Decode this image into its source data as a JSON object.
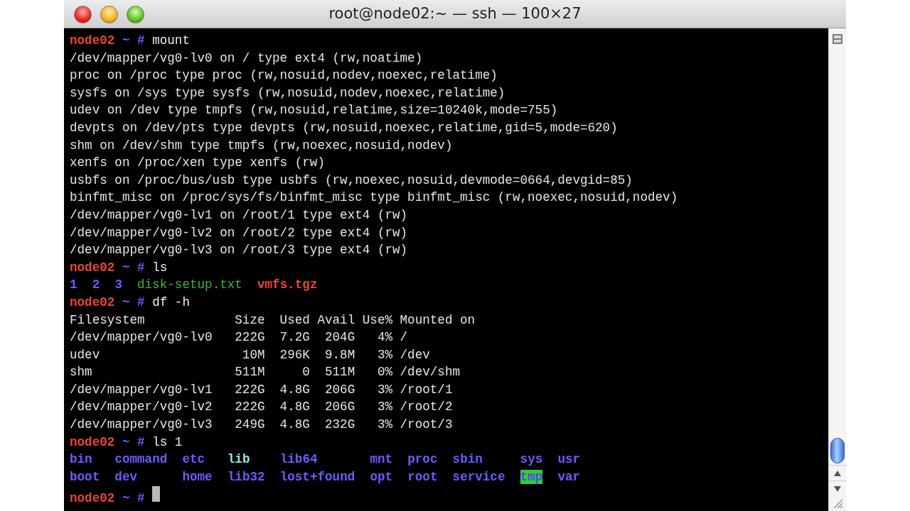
{
  "window": {
    "title": "root@node02:~ — ssh — 100×27"
  },
  "terminal": {
    "blocks": [
      {
        "kind": "prompt",
        "host": "node02",
        "path": "~",
        "symbol": "#",
        "command": "mount"
      },
      {
        "kind": "output",
        "lines": [
          "/dev/mapper/vg0-lv0 on / type ext4 (rw,noatime)",
          "proc on /proc type proc (rw,nosuid,nodev,noexec,relatime)",
          "sysfs on /sys type sysfs (rw,nosuid,nodev,noexec,relatime)",
          "udev on /dev type tmpfs (rw,nosuid,relatime,size=10240k,mode=755)",
          "devpts on /dev/pts type devpts (rw,nosuid,noexec,relatime,gid=5,mode=620)",
          "shm on /dev/shm type tmpfs (rw,noexec,nosuid,nodev)",
          "xenfs on /proc/xen type xenfs (rw)",
          "usbfs on /proc/bus/usb type usbfs (rw,noexec,nosuid,devmode=0664,devgid=85)",
          "binfmt_misc on /proc/sys/fs/binfmt_misc type binfmt_misc (rw,noexec,nosuid,nodev)",
          "/dev/mapper/vg0-lv1 on /root/1 type ext4 (rw)",
          "/dev/mapper/vg0-lv2 on /root/2 type ext4 (rw)",
          "/dev/mapper/vg0-lv3 on /root/3 type ext4 (rw)"
        ]
      },
      {
        "kind": "prompt",
        "host": "node02",
        "path": "~",
        "symbol": "#",
        "command": "ls"
      },
      {
        "kind": "listing",
        "rows": [
          [
            {
              "name": "1",
              "kind": "dir"
            },
            {
              "name": "2",
              "kind": "dir"
            },
            {
              "name": "3",
              "kind": "dir"
            },
            {
              "name": "disk-setup.txt",
              "kind": "text"
            },
            {
              "name": "vmfs.tgz",
              "kind": "archive"
            }
          ]
        ]
      },
      {
        "kind": "prompt",
        "host": "node02",
        "path": "~",
        "symbol": "#",
        "command": "df -h"
      },
      {
        "kind": "output",
        "lines": [
          "Filesystem            Size  Used Avail Use% Mounted on",
          "/dev/mapper/vg0-lv0   222G  7.2G  204G   4% /",
          "udev                   10M  296K  9.8M   3% /dev",
          "shm                   511M     0  511M   0% /dev/shm",
          "/dev/mapper/vg0-lv1   222G  4.8G  206G   3% /root/1",
          "/dev/mapper/vg0-lv2   222G  4.8G  206G   3% /root/2",
          "/dev/mapper/vg0-lv3   249G  4.8G  232G   3% /root/3"
        ]
      },
      {
        "kind": "prompt",
        "host": "node02",
        "path": "~",
        "symbol": "#",
        "command": "ls 1"
      },
      {
        "kind": "listing",
        "rows": [
          [
            {
              "name": "bin",
              "kind": "dir"
            },
            {
              "name": "command",
              "kind": "dir"
            },
            {
              "name": "etc",
              "kind": "dir"
            },
            {
              "name": "lib",
              "kind": "link"
            },
            {
              "name": "lib64",
              "kind": "dir"
            },
            {
              "name": "mnt",
              "kind": "dir"
            },
            {
              "name": "proc",
              "kind": "dir"
            },
            {
              "name": "sbin",
              "kind": "dir"
            },
            {
              "name": "sys",
              "kind": "dir"
            },
            {
              "name": "usr",
              "kind": "dir"
            }
          ],
          [
            {
              "name": "boot",
              "kind": "dir"
            },
            {
              "name": "dev",
              "kind": "dir"
            },
            {
              "name": "home",
              "kind": "dir"
            },
            {
              "name": "lib32",
              "kind": "dir"
            },
            {
              "name": "lost+found",
              "kind": "dir"
            },
            {
              "name": "opt",
              "kind": "dir"
            },
            {
              "name": "root",
              "kind": "dir"
            },
            {
              "name": "service",
              "kind": "dir"
            },
            {
              "name": "tmp",
              "kind": "sticky"
            },
            {
              "name": "var",
              "kind": "dir"
            }
          ]
        ]
      },
      {
        "kind": "prompt",
        "host": "node02",
        "path": "~",
        "symbol": "#",
        "cursor": true
      }
    ]
  }
}
